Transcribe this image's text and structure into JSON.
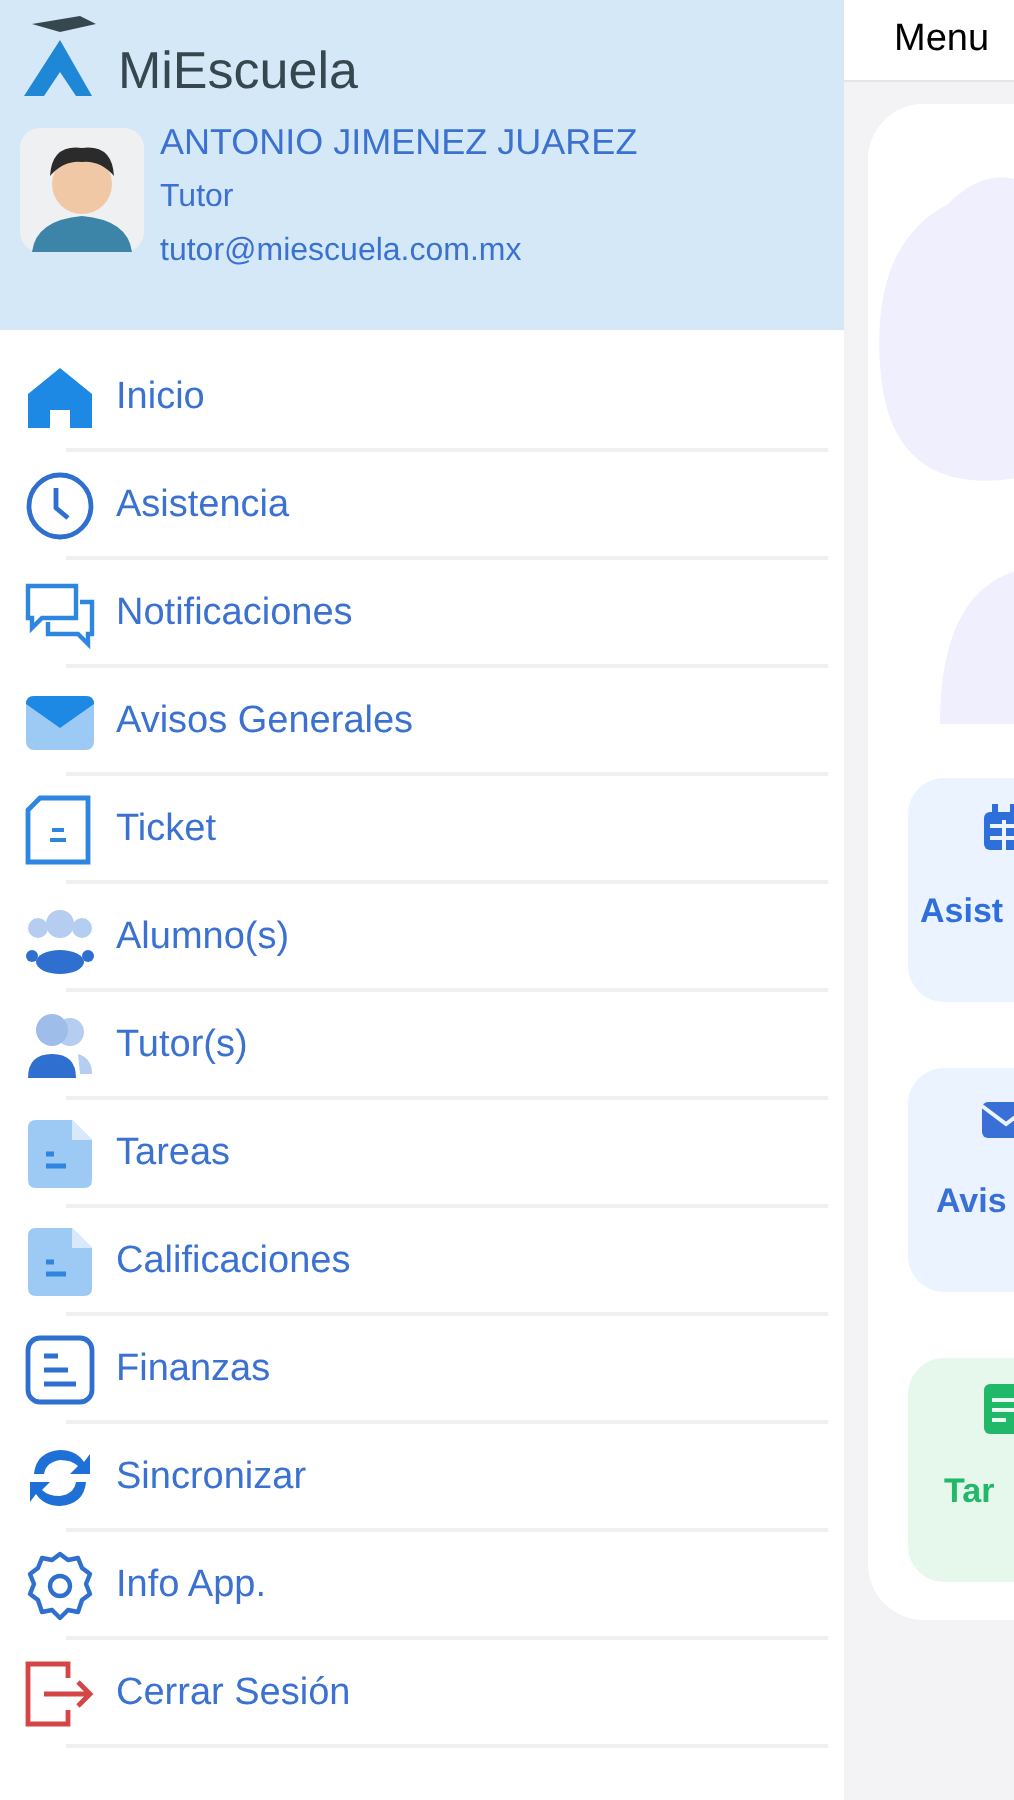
{
  "drawer": {
    "app_name": "MiEscuela",
    "user": {
      "name": "ANTONIO JIMENEZ JUAREZ",
      "role": "Tutor",
      "email": "tutor@miescuela.com.mx"
    },
    "items": [
      {
        "label": "Inicio",
        "kind": "home"
      },
      {
        "label": "Asistencia",
        "kind": "clock"
      },
      {
        "label": "Notificaciones",
        "kind": "chat"
      },
      {
        "label": "Avisos Generales",
        "kind": "mail"
      },
      {
        "label": "Ticket",
        "kind": "ticket"
      },
      {
        "label": "Alumno(s)",
        "kind": "group"
      },
      {
        "label": "Tutor(s)",
        "kind": "people"
      },
      {
        "label": "Tareas",
        "kind": "doc"
      },
      {
        "label": "Calificaciones",
        "kind": "doc"
      },
      {
        "label": "Finanzas",
        "kind": "list"
      },
      {
        "label": "Sincronizar",
        "kind": "sync"
      },
      {
        "label": "Info App.",
        "kind": "gear"
      },
      {
        "label": "Cerrar Sesión",
        "kind": "logout"
      }
    ]
  },
  "main": {
    "title": "Menu",
    "tiles": [
      {
        "label": "Asist",
        "kind": "calendar",
        "color": "#2f6fdc"
      },
      {
        "label": "Avis",
        "kind": "mail",
        "color": "#3a6fd8"
      },
      {
        "label": "Tar",
        "kind": "doc",
        "color": "#22b86a"
      }
    ]
  }
}
